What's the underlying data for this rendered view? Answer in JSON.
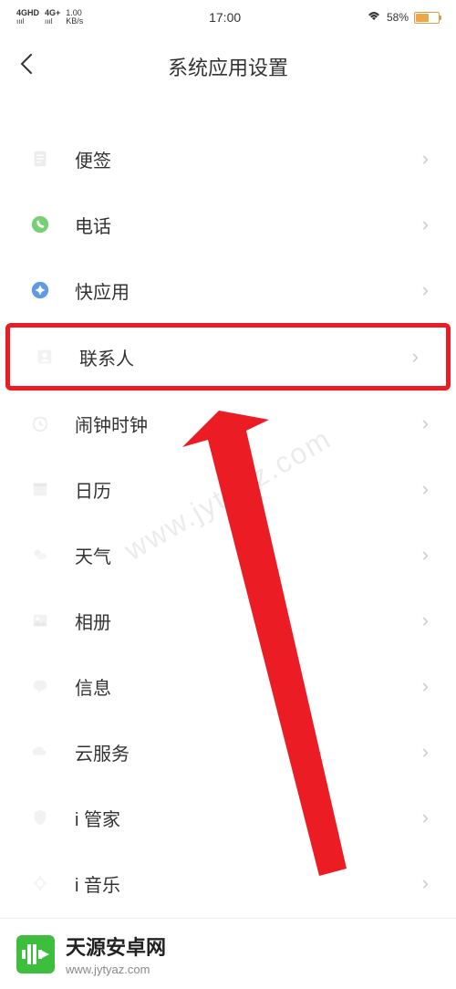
{
  "status": {
    "signal1": "4GHD",
    "signal2": "4G+",
    "speed_top": "1.00",
    "speed_bottom": "KB/s",
    "time": "17:00",
    "battery_pct": "58%"
  },
  "header": {
    "title": "系统应用设置"
  },
  "items": [
    {
      "id": "notes",
      "label": "便签",
      "icon": "note-icon"
    },
    {
      "id": "phone",
      "label": "电话",
      "icon": "phone-icon"
    },
    {
      "id": "quickapp",
      "label": "快应用",
      "icon": "compass-icon"
    },
    {
      "id": "contacts",
      "label": "联系人",
      "icon": "contacts-icon",
      "highlight": true
    },
    {
      "id": "alarm",
      "label": "闹钟时钟",
      "icon": "clock-icon"
    },
    {
      "id": "calendar",
      "label": "日历",
      "icon": "calendar-icon"
    },
    {
      "id": "weather",
      "label": "天气",
      "icon": "weather-icon"
    },
    {
      "id": "gallery",
      "label": "相册",
      "icon": "gallery-icon"
    },
    {
      "id": "messages",
      "label": "信息",
      "icon": "message-icon"
    },
    {
      "id": "cloud",
      "label": "云服务",
      "icon": "cloud-icon"
    },
    {
      "id": "manager",
      "label": "i 管家",
      "icon": "shield-icon"
    },
    {
      "id": "music",
      "label": "i 音乐",
      "icon": "music-icon"
    }
  ],
  "watermark": "www.jytyaz.com",
  "footer": {
    "title": "天源安卓网",
    "url": "www.jytyaz.com"
  }
}
